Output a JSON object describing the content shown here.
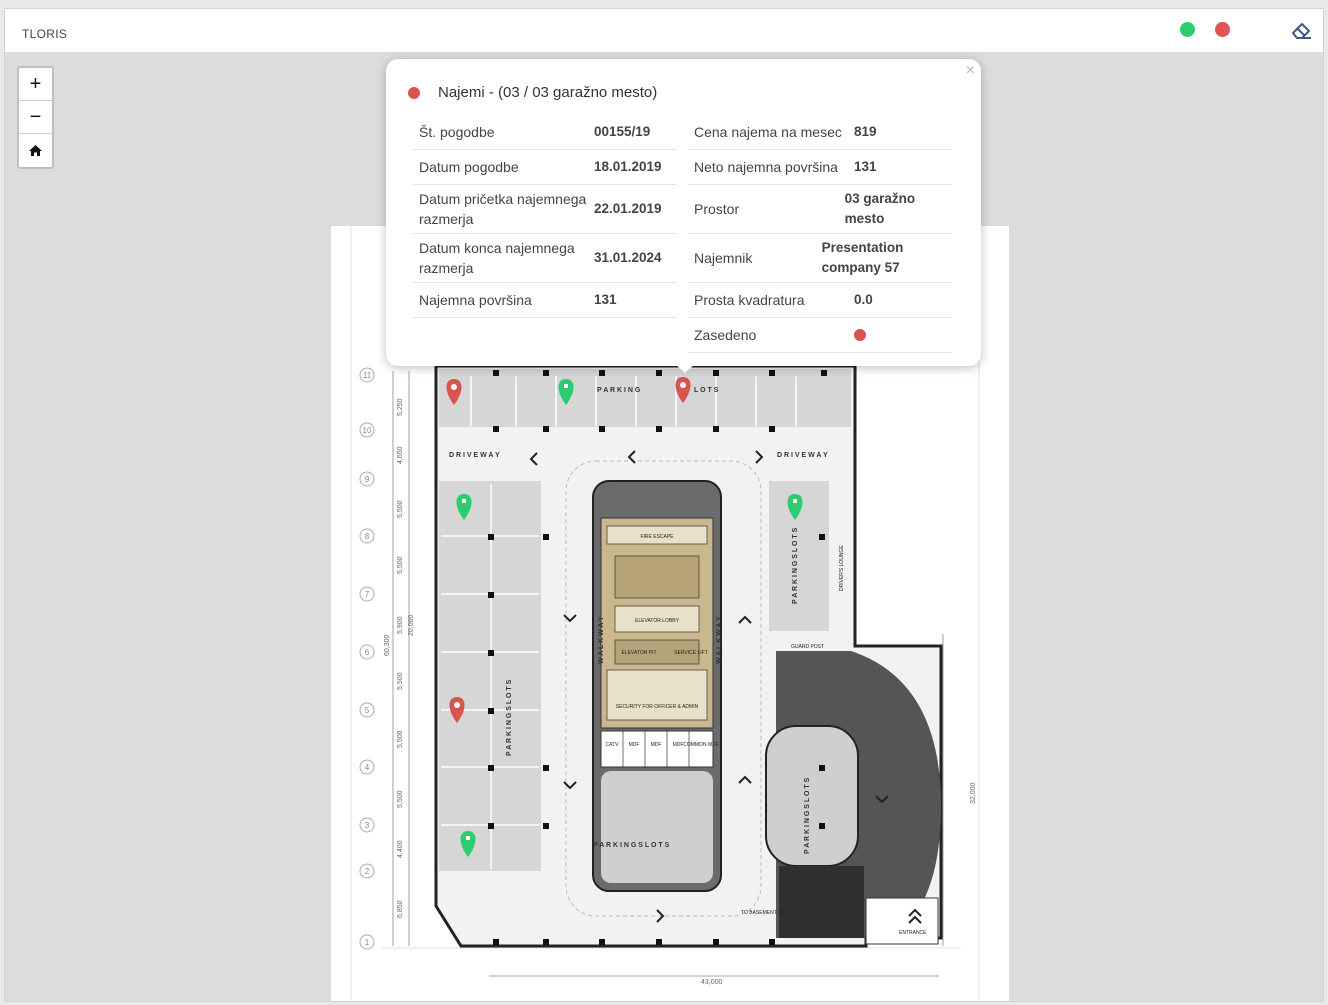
{
  "header": {
    "title": "TLORIS",
    "legend_colors": {
      "available": "#2ecc71",
      "occupied": "#e05555"
    },
    "eraser_icon": "eraser-icon"
  },
  "zoom": {
    "in": "+",
    "out": "−",
    "home_icon": "home-icon"
  },
  "popup": {
    "title": "Najemi - (03 / 03 garažno mesto)",
    "close": "×",
    "left": [
      {
        "label": "Št. pogodbe",
        "value": "00155/19"
      },
      {
        "label": "Datum pogodbe",
        "value": "18.01.2019"
      },
      {
        "label": "Datum pričetka najemnega razmerja",
        "value": "22.01.2019"
      },
      {
        "label": "Datum konca najemnega razmerja",
        "value": "31.01.2024"
      },
      {
        "label": "Najemna površina",
        "value": "131"
      }
    ],
    "right": [
      {
        "label": "Cena najema na mesec",
        "value": "819"
      },
      {
        "label": "Neto najemna površina",
        "value": "131"
      },
      {
        "label": "Prostor",
        "value": "03 garažno mesto"
      },
      {
        "label": "Najemnik",
        "value": "Presentation company 57"
      },
      {
        "label": "Prosta kvadratura",
        "value": "0.0"
      },
      {
        "label": "Zasedeno",
        "value": ""
      }
    ]
  },
  "plan": {
    "labels": {
      "parking_top_left": "P A R K I N G",
      "parking_top_right": "L O T S",
      "driveway_left": "D R I V E W A Y",
      "driveway_right": "D R I V E W A Y",
      "parking_left_vertical": "P A R K I N G   S L O T S",
      "parking_right_vertical": "P A R K I N G   S L O T S",
      "parking_bottom": "P A R K I N G     S L O T S",
      "parking_curve": "P A R K I N G   S L O T S",
      "walkway": "W A L K W A Y",
      "elevator_lobby": "ELEVATOR LOBBY",
      "elevator_pit": "ELEVATOR PIT",
      "service_lift": "SERVICE LIFT",
      "security": "SECURITY FOR OFFICER & ADMIN",
      "drivers_lounge": "DRIVER'S LOUNGE",
      "guard_post": "GUARD POST",
      "to_basement": "TO BASEMENT 2",
      "entrance": "ENTRANCE",
      "catv": "CATV",
      "mdf": "MDF",
      "common_mdf": "COMMON MDF",
      "fire_escape": "FIRE ESCAPE",
      "dim_width": "43,000",
      "dim_height": "60,300",
      "dim_inner": "20,000",
      "dim_right": "32,000"
    },
    "grid_rows": [
      "11",
      "10",
      "9",
      "8",
      "7",
      "6",
      "5",
      "4",
      "3",
      "2",
      "1"
    ],
    "row_dims": [
      "5,250",
      "4,650",
      "5,500",
      "5,500",
      "5,900",
      "5,500",
      "5,500",
      "5,500",
      "4,400",
      "6,850"
    ]
  }
}
